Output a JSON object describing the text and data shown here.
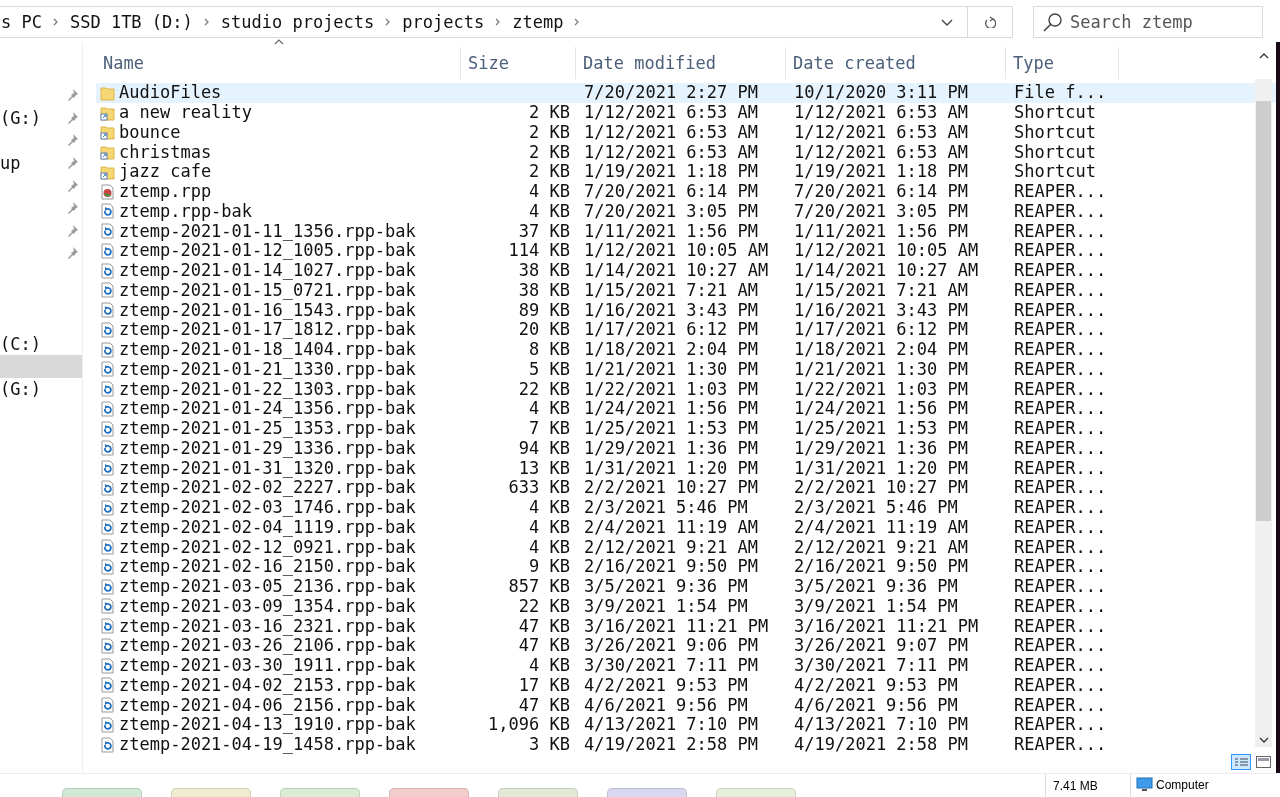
{
  "address_bar": {
    "crumbs": [
      "s PC",
      "SSD 1TB (D:)",
      "studio projects",
      "projects",
      "ztemp"
    ],
    "search": {
      "placeholder": "Search ztemp"
    }
  },
  "sidebar": {
    "items": [
      {
        "pinned": true,
        "selected": false
      },
      {
        "label": "(G:)",
        "pinned": true,
        "selected": false
      },
      {
        "pinned": true,
        "selected": false
      },
      {
        "label": "up",
        "pinned": true,
        "selected": false
      },
      {
        "pinned": true,
        "selected": false
      },
      {
        "pinned": true,
        "selected": false
      },
      {
        "pinned": true,
        "selected": false
      },
      {
        "pinned": true,
        "selected": false
      },
      {
        "pinned": false,
        "selected": false
      },
      {
        "pinned": false,
        "selected": false
      },
      {
        "pinned": false,
        "selected": false
      },
      {
        "label": "(C:)",
        "pinned": false,
        "selected": false
      },
      {
        "pinned": false,
        "selected": true
      },
      {
        "label": "(G:)",
        "pinned": false,
        "selected": false
      }
    ]
  },
  "table": {
    "columns": [
      "Name",
      "Size",
      "Date modified",
      "Date created",
      "Type"
    ],
    "rows": [
      {
        "kind": "folder",
        "selected": true,
        "cells": [
          "AudioFiles",
          "",
          "7/20/2021 2:27 PM",
          "10/1/2020 3:11 PM",
          "File f..."
        ]
      },
      {
        "kind": "shortcut",
        "selected": false,
        "cells": [
          "a new reality",
          "2 KB",
          "1/12/2021 6:53 AM",
          "1/12/2021 6:53 AM",
          "Shortcut"
        ]
      },
      {
        "kind": "shortcut",
        "selected": false,
        "cells": [
          "bounce",
          "2 KB",
          "1/12/2021 6:53 AM",
          "1/12/2021 6:53 AM",
          "Shortcut"
        ]
      },
      {
        "kind": "shortcut",
        "selected": false,
        "cells": [
          "christmas",
          "2 KB",
          "1/12/2021 6:53 AM",
          "1/12/2021 6:53 AM",
          "Shortcut"
        ]
      },
      {
        "kind": "shortcut",
        "selected": false,
        "cells": [
          "jazz cafe",
          "2 KB",
          "1/19/2021 1:18 PM",
          "1/19/2021 1:18 PM",
          "Shortcut"
        ]
      },
      {
        "kind": "project",
        "selected": false,
        "cells": [
          "ztemp.rpp",
          "4 KB",
          "7/20/2021 6:14 PM",
          "7/20/2021 6:14 PM",
          "REAPER..."
        ]
      },
      {
        "kind": "backup",
        "selected": false,
        "cells": [
          "ztemp.rpp-bak",
          "4 KB",
          "7/20/2021 3:05 PM",
          "7/20/2021 3:05 PM",
          "REAPER..."
        ]
      },
      {
        "kind": "backup",
        "selected": false,
        "cells": [
          "ztemp-2021-01-11_1356.rpp-bak",
          "37 KB",
          "1/11/2021 1:56 PM",
          "1/11/2021 1:56 PM",
          "REAPER..."
        ]
      },
      {
        "kind": "backup",
        "selected": false,
        "cells": [
          "ztemp-2021-01-12_1005.rpp-bak",
          "114 KB",
          "1/12/2021 10:05 AM",
          "1/12/2021 10:05 AM",
          "REAPER..."
        ]
      },
      {
        "kind": "backup",
        "selected": false,
        "cells": [
          "ztemp-2021-01-14_1027.rpp-bak",
          "38 KB",
          "1/14/2021 10:27 AM",
          "1/14/2021 10:27 AM",
          "REAPER..."
        ]
      },
      {
        "kind": "backup",
        "selected": false,
        "cells": [
          "ztemp-2021-01-15_0721.rpp-bak",
          "38 KB",
          "1/15/2021 7:21 AM",
          "1/15/2021 7:21 AM",
          "REAPER..."
        ]
      },
      {
        "kind": "backup",
        "selected": false,
        "cells": [
          "ztemp-2021-01-16_1543.rpp-bak",
          "89 KB",
          "1/16/2021 3:43 PM",
          "1/16/2021 3:43 PM",
          "REAPER..."
        ]
      },
      {
        "kind": "backup",
        "selected": false,
        "cells": [
          "ztemp-2021-01-17_1812.rpp-bak",
          "20 KB",
          "1/17/2021 6:12 PM",
          "1/17/2021 6:12 PM",
          "REAPER..."
        ]
      },
      {
        "kind": "backup",
        "selected": false,
        "cells": [
          "ztemp-2021-01-18_1404.rpp-bak",
          "8 KB",
          "1/18/2021 2:04 PM",
          "1/18/2021 2:04 PM",
          "REAPER..."
        ]
      },
      {
        "kind": "backup",
        "selected": false,
        "cells": [
          "ztemp-2021-01-21_1330.rpp-bak",
          "5 KB",
          "1/21/2021 1:30 PM",
          "1/21/2021 1:30 PM",
          "REAPER..."
        ]
      },
      {
        "kind": "backup",
        "selected": false,
        "cells": [
          "ztemp-2021-01-22_1303.rpp-bak",
          "22 KB",
          "1/22/2021 1:03 PM",
          "1/22/2021 1:03 PM",
          "REAPER..."
        ]
      },
      {
        "kind": "backup",
        "selected": false,
        "cells": [
          "ztemp-2021-01-24_1356.rpp-bak",
          "4 KB",
          "1/24/2021 1:56 PM",
          "1/24/2021 1:56 PM",
          "REAPER..."
        ]
      },
      {
        "kind": "backup",
        "selected": false,
        "cells": [
          "ztemp-2021-01-25_1353.rpp-bak",
          "7 KB",
          "1/25/2021 1:53 PM",
          "1/25/2021 1:53 PM",
          "REAPER..."
        ]
      },
      {
        "kind": "backup",
        "selected": false,
        "cells": [
          "ztemp-2021-01-29_1336.rpp-bak",
          "94 KB",
          "1/29/2021 1:36 PM",
          "1/29/2021 1:36 PM",
          "REAPER..."
        ]
      },
      {
        "kind": "backup",
        "selected": false,
        "cells": [
          "ztemp-2021-01-31_1320.rpp-bak",
          "13 KB",
          "1/31/2021 1:20 PM",
          "1/31/2021 1:20 PM",
          "REAPER..."
        ]
      },
      {
        "kind": "backup",
        "selected": false,
        "cells": [
          "ztemp-2021-02-02_2227.rpp-bak",
          "633 KB",
          "2/2/2021 10:27 PM",
          "2/2/2021 10:27 PM",
          "REAPER..."
        ]
      },
      {
        "kind": "backup",
        "selected": false,
        "cells": [
          "ztemp-2021-02-03_1746.rpp-bak",
          "4 KB",
          "2/3/2021 5:46 PM",
          "2/3/2021 5:46 PM",
          "REAPER..."
        ]
      },
      {
        "kind": "backup",
        "selected": false,
        "cells": [
          "ztemp-2021-02-04_1119.rpp-bak",
          "4 KB",
          "2/4/2021 11:19 AM",
          "2/4/2021 11:19 AM",
          "REAPER..."
        ]
      },
      {
        "kind": "backup",
        "selected": false,
        "cells": [
          "ztemp-2021-02-12_0921.rpp-bak",
          "4 KB",
          "2/12/2021 9:21 AM",
          "2/12/2021 9:21 AM",
          "REAPER..."
        ]
      },
      {
        "kind": "backup",
        "selected": false,
        "cells": [
          "ztemp-2021-02-16_2150.rpp-bak",
          "9 KB",
          "2/16/2021 9:50 PM",
          "2/16/2021 9:50 PM",
          "REAPER..."
        ]
      },
      {
        "kind": "backup",
        "selected": false,
        "cells": [
          "ztemp-2021-03-05_2136.rpp-bak",
          "857 KB",
          "3/5/2021 9:36 PM",
          "3/5/2021 9:36 PM",
          "REAPER..."
        ]
      },
      {
        "kind": "backup",
        "selected": false,
        "cells": [
          "ztemp-2021-03-09_1354.rpp-bak",
          "22 KB",
          "3/9/2021 1:54 PM",
          "3/9/2021 1:54 PM",
          "REAPER..."
        ]
      },
      {
        "kind": "backup",
        "selected": false,
        "cells": [
          "ztemp-2021-03-16_2321.rpp-bak",
          "47 KB",
          "3/16/2021 11:21 PM",
          "3/16/2021 11:21 PM",
          "REAPER..."
        ]
      },
      {
        "kind": "backup",
        "selected": false,
        "cells": [
          "ztemp-2021-03-26_2106.rpp-bak",
          "47 KB",
          "3/26/2021 9:06 PM",
          "3/26/2021 9:07 PM",
          "REAPER..."
        ]
      },
      {
        "kind": "backup",
        "selected": false,
        "cells": [
          "ztemp-2021-03-30_1911.rpp-bak",
          "4 KB",
          "3/30/2021 7:11 PM",
          "3/30/2021 7:11 PM",
          "REAPER..."
        ]
      },
      {
        "kind": "backup",
        "selected": false,
        "cells": [
          "ztemp-2021-04-02_2153.rpp-bak",
          "17 KB",
          "4/2/2021 9:53 PM",
          "4/2/2021 9:53 PM",
          "REAPER..."
        ]
      },
      {
        "kind": "backup",
        "selected": false,
        "cells": [
          "ztemp-2021-04-06_2156.rpp-bak",
          "47 KB",
          "4/6/2021 9:56 PM",
          "4/6/2021 9:56 PM",
          "REAPER..."
        ]
      },
      {
        "kind": "backup",
        "selected": false,
        "cells": [
          "ztemp-2021-04-13_1910.rpp-bak",
          "1,096 KB",
          "4/13/2021 7:10 PM",
          "4/13/2021 7:10 PM",
          "REAPER..."
        ]
      },
      {
        "kind": "backup",
        "selected": false,
        "cells": [
          "ztemp-2021-04-19_1458.rpp-bak",
          "3 KB",
          "4/19/2021 2:58 PM",
          "4/19/2021 2:58 PM",
          "REAPER..."
        ]
      }
    ]
  },
  "status_bar": {
    "size": "7.41 MB",
    "location": "Computer"
  },
  "taskbar": {
    "buttons": [
      {
        "color": "#cfe9d4"
      },
      {
        "color": "#f0ecd0"
      },
      {
        "color": "#d9ecd5"
      },
      {
        "color": "#f3cccc"
      },
      {
        "color": "#e2ead7"
      },
      {
        "color": "#d8d8f0"
      },
      {
        "color": "#e6efd9"
      }
    ]
  }
}
